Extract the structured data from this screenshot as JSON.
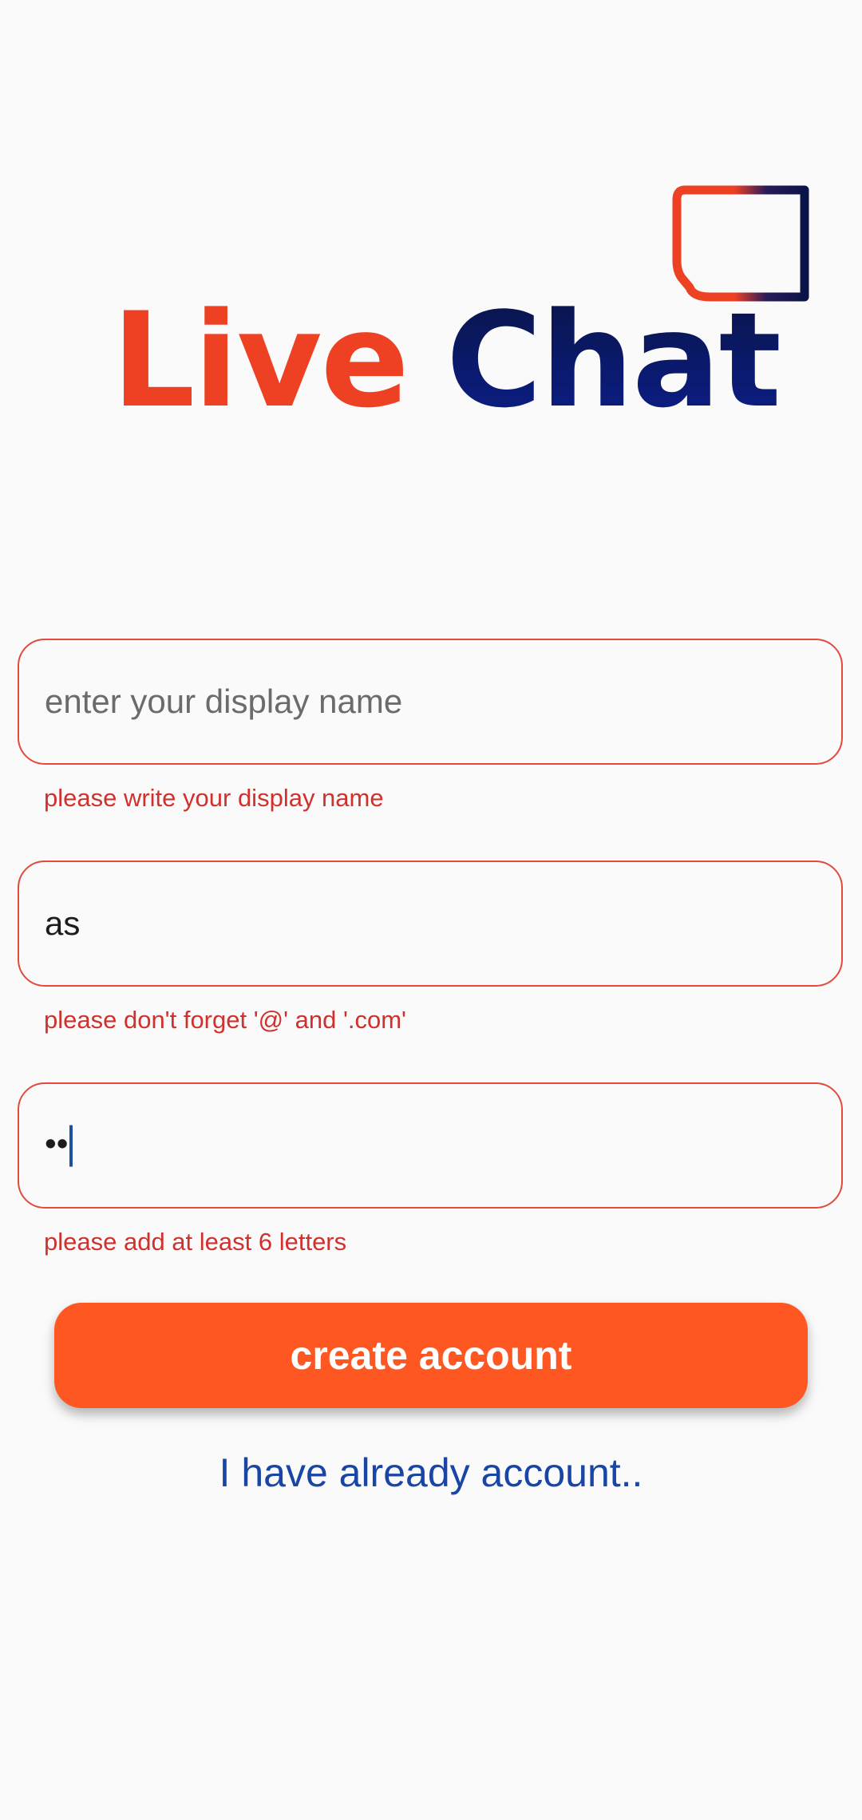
{
  "logo": {
    "word_live": "Live",
    "word_chat": "Chat",
    "icon": "chat-bubble-icon"
  },
  "form": {
    "display_name": {
      "value": "",
      "placeholder": "enter your display name",
      "error": "please write your display name"
    },
    "email": {
      "value": "as",
      "placeholder": "",
      "error": "please don't forget '@' and '.com'"
    },
    "password": {
      "masked_value": "••",
      "placeholder": "",
      "error": "please add at least 6 letters"
    }
  },
  "actions": {
    "create_account_label": "create account",
    "login_link_label": "I have already account.."
  },
  "colors": {
    "brand_orange": "#FF5722",
    "logo_red": "#EE4023",
    "logo_navy": "#0B1E8C",
    "error_red": "#D0312D",
    "link_blue": "#1946A5",
    "background": "#FAFAFA"
  }
}
